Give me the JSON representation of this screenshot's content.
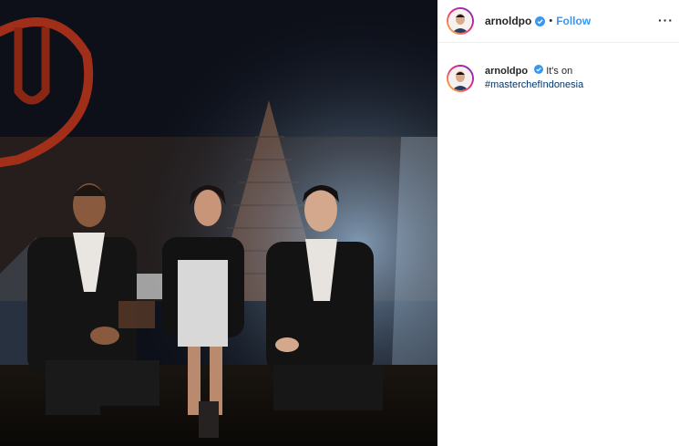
{
  "post": {
    "username": "arnoldpo",
    "follow_label": "Follow",
    "separator": "•",
    "more_label": "···",
    "verified_icon": "verified-badge-icon"
  },
  "caption": {
    "username": "arnoldpo",
    "text": "It's on",
    "hashtag": "#masterchefIndonesia"
  },
  "colors": {
    "link_blue": "#3897f0",
    "hashtag_blue": "#003569",
    "text": "#262626",
    "verified": "#3897f0"
  }
}
